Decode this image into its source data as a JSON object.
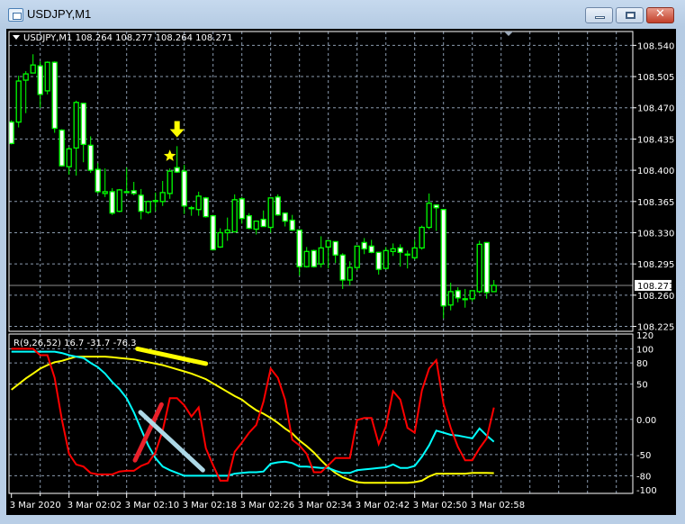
{
  "window": {
    "title": "USDJPY,M1",
    "buttons": {
      "minimize": "minimize",
      "maximize": "maximize",
      "close": "✕"
    }
  },
  "chart_data": [
    {
      "type": "candlestick",
      "header": "USDJPY,M1  108.264 108.277 108.264 108.271",
      "symbol": "USDJPY,M1",
      "ohlc_header": [
        108.264,
        108.277,
        108.264,
        108.271
      ],
      "ylim": [
        108.2195,
        108.5555
      ],
      "y_ticks": [
        "108.540",
        "108.505",
        "108.470",
        "108.435",
        "108.400",
        "108.365",
        "108.330",
        "108.295",
        "108.260",
        "108.225"
      ],
      "current_price": "108.271",
      "grid": true,
      "colors": {
        "candle_outline": "#00ff00",
        "bear_fill": "#ffffff",
        "bull_fill": "#000000",
        "grid": "#8a9aae",
        "price_line": "#8c8c8c"
      },
      "candles_ohlc": [
        [
          108.454,
          108.456,
          108.429,
          108.43
        ],
        [
          108.454,
          108.506,
          108.448,
          108.5
        ],
        [
          108.501,
          108.511,
          108.464,
          108.508
        ],
        [
          108.509,
          108.53,
          108.509,
          108.518
        ],
        [
          108.517,
          108.522,
          108.47,
          108.485
        ],
        [
          108.489,
          108.522,
          108.485,
          108.521
        ],
        [
          108.521,
          108.522,
          108.442,
          108.447
        ],
        [
          108.445,
          108.446,
          108.404,
          108.405
        ],
        [
          108.404,
          108.426,
          108.395,
          108.424
        ],
        [
          108.425,
          108.478,
          108.394,
          108.476
        ],
        [
          108.475,
          108.475,
          108.409,
          108.429
        ],
        [
          108.428,
          108.438,
          108.397,
          108.4
        ],
        [
          108.401,
          108.408,
          108.374,
          108.376
        ],
        [
          108.374,
          108.402,
          108.37,
          108.376
        ],
        [
          108.376,
          108.38,
          108.35,
          108.352
        ],
        [
          108.354,
          108.379,
          108.353,
          108.378
        ],
        [
          108.376,
          108.403,
          108.375,
          108.376
        ],
        [
          108.377,
          108.387,
          108.372,
          108.374
        ],
        [
          108.372,
          108.379,
          108.345,
          108.354
        ],
        [
          108.353,
          108.366,
          108.351,
          108.365
        ],
        [
          108.366,
          108.375,
          108.354,
          108.366
        ],
        [
          108.365,
          108.388,
          108.36,
          108.375
        ],
        [
          108.374,
          108.402,
          108.368,
          108.399
        ],
        [
          108.403,
          108.427,
          108.397,
          108.398
        ],
        [
          108.399,
          108.406,
          108.351,
          108.36
        ],
        [
          108.358,
          108.36,
          108.349,
          108.358
        ],
        [
          108.356,
          108.376,
          108.349,
          108.371
        ],
        [
          108.369,
          108.37,
          108.347,
          108.348
        ],
        [
          108.349,
          108.35,
          108.31,
          108.311
        ],
        [
          108.314,
          108.335,
          108.313,
          108.33
        ],
        [
          108.33,
          108.347,
          108.321,
          108.333
        ],
        [
          108.331,
          108.373,
          108.331,
          108.367
        ],
        [
          108.368,
          108.37,
          108.34,
          108.346
        ],
        [
          108.349,
          108.352,
          108.334,
          108.335
        ],
        [
          108.334,
          108.343,
          108.328,
          108.343
        ],
        [
          108.345,
          108.355,
          108.337,
          108.337
        ],
        [
          108.336,
          108.369,
          108.33,
          108.369
        ],
        [
          108.37,
          108.373,
          108.349,
          108.35
        ],
        [
          108.352,
          108.352,
          108.337,
          108.343
        ],
        [
          108.344,
          108.35,
          108.332,
          108.333
        ],
        [
          108.333,
          108.333,
          108.282,
          108.292
        ],
        [
          108.292,
          108.314,
          108.291,
          108.309
        ],
        [
          108.31,
          108.311,
          108.291,
          108.292
        ],
        [
          108.295,
          108.326,
          108.291,
          108.313
        ],
        [
          108.314,
          108.321,
          108.29,
          108.321
        ],
        [
          108.32,
          108.32,
          108.296,
          108.305
        ],
        [
          108.305,
          108.307,
          108.267,
          108.277
        ],
        [
          108.277,
          108.298,
          108.271,
          108.291
        ],
        [
          108.291,
          108.315,
          108.288,
          108.315
        ],
        [
          108.319,
          108.324,
          108.306,
          108.312
        ],
        [
          108.315,
          108.322,
          108.307,
          108.308
        ],
        [
          108.308,
          108.308,
          108.283,
          108.289
        ],
        [
          108.29,
          108.314,
          108.29,
          108.31
        ],
        [
          108.309,
          108.318,
          108.304,
          108.312
        ],
        [
          108.313,
          108.317,
          108.292,
          108.308
        ],
        [
          108.306,
          108.31,
          108.29,
          108.306
        ],
        [
          108.302,
          108.322,
          108.3,
          108.313
        ],
        [
          108.313,
          108.338,
          108.311,
          108.336
        ],
        [
          108.336,
          108.374,
          108.334,
          108.363
        ],
        [
          108.361,
          108.361,
          108.332,
          108.358
        ],
        [
          108.356,
          108.356,
          108.234,
          108.248
        ],
        [
          108.249,
          108.274,
          108.243,
          108.264
        ],
        [
          108.265,
          108.269,
          108.252,
          108.257
        ],
        [
          108.256,
          108.267,
          108.246,
          108.256
        ],
        [
          108.256,
          108.265,
          108.253,
          108.265
        ],
        [
          108.264,
          108.321,
          108.262,
          108.317
        ],
        [
          108.319,
          108.319,
          108.256,
          108.263
        ],
        [
          108.264,
          108.277,
          108.264,
          108.271
        ]
      ],
      "objects": [
        {
          "kind": "arrow-down",
          "time": "02:17",
          "price": 108.444,
          "color": "#ffff00"
        },
        {
          "kind": "star",
          "time": "02:16",
          "price": 108.416,
          "color": "#ffff00"
        }
      ]
    },
    {
      "type": "line",
      "header": "R(9,26,52) 16.7 -31.7 -76.3",
      "label": "R(9,26,52)",
      "last_values": [
        "16.7",
        "-31.7",
        "-76.3"
      ],
      "ylim": [
        -105,
        121
      ],
      "y_ticks": [
        "120",
        "100",
        "80",
        "50",
        "0.00",
        "-50",
        "-80",
        "-100"
      ],
      "grid_levels": [
        100,
        80,
        50,
        0,
        -50,
        -80
      ],
      "series": [
        {
          "color": "#ff0000",
          "values": [
            100,
            100,
            100,
            100,
            91,
            91,
            59,
            0,
            -49,
            -64,
            -67,
            -76,
            -78,
            -78,
            -78,
            -74,
            -73,
            -73,
            -66,
            -62,
            -47,
            -16,
            30,
            30,
            20,
            4,
            17,
            -41,
            -65,
            -87,
            -87,
            -46,
            -33,
            -19,
            -8,
            25,
            72,
            59,
            28,
            -29,
            -37,
            -49,
            -75,
            -75,
            -65,
            -55,
            -55,
            -55,
            -1,
            2,
            2,
            -35,
            -10,
            40,
            28,
            -12,
            -19,
            41,
            72,
            84,
            22,
            -12,
            -39,
            -58,
            -58,
            -41,
            -27,
            16.7
          ]
        },
        {
          "color": "#00ffff",
          "values": [
            96,
            96,
            96,
            96,
            96,
            96,
            96,
            94,
            91,
            89,
            87,
            80,
            74,
            65,
            53,
            43,
            30,
            10,
            -14,
            -37,
            -55,
            -67,
            -72,
            -76,
            -80,
            -80,
            -80,
            -80,
            -80,
            -80,
            -80,
            -77,
            -76,
            -75,
            -75,
            -74,
            -63,
            -61,
            -60,
            -62,
            -67,
            -67,
            -68,
            -69,
            -69,
            -73,
            -76,
            -76,
            -72,
            -71,
            -70,
            -69,
            -68,
            -64,
            -69,
            -69,
            -66,
            -53,
            -37,
            -16,
            -19,
            -22,
            -23,
            -25,
            -27,
            -13,
            -23,
            -31.7
          ]
        },
        {
          "color": "#ffff00",
          "values": [
            42,
            50,
            58,
            65,
            72,
            77,
            81,
            83,
            86,
            89,
            89,
            89,
            89,
            89,
            88,
            87,
            86,
            85,
            83,
            81,
            79,
            77,
            74,
            71,
            68,
            65,
            61,
            57,
            51,
            45,
            39,
            33,
            28,
            20,
            13,
            8,
            2,
            -5,
            -13,
            -20,
            -30,
            -38,
            -47,
            -58,
            -68,
            -76,
            -82,
            -86,
            -89,
            -90,
            -90,
            -90,
            -90,
            -90,
            -90,
            -90,
            -89,
            -87,
            -81,
            -77,
            -77,
            -77,
            -77,
            -77,
            -76,
            -76,
            -76,
            -76.3
          ]
        }
      ],
      "objects": [
        {
          "kind": "trendline",
          "color": "#ffff00",
          "from": {
            "time": "02:11:30",
            "value": 100
          },
          "to": {
            "time": "02:21",
            "value": 79
          }
        },
        {
          "kind": "trendline",
          "color": "#e8202a",
          "from": {
            "time": "02:11:10",
            "value": -58
          },
          "to": {
            "time": "02:14:50",
            "value": 21
          }
        },
        {
          "kind": "trendline",
          "color": "#add8e6",
          "from": {
            "time": "02:11:55",
            "value": 10
          },
          "to": {
            "time": "02:20:35",
            "value": -72
          }
        }
      ]
    }
  ],
  "time_axis": {
    "labels": [
      "3 Mar 2020",
      "3 Mar 02:02",
      "3 Mar 02:10",
      "3 Mar 02:18",
      "3 Mar 02:26",
      "3 Mar 02:34",
      "3 Mar 02:42",
      "3 Mar 02:50",
      "3 Mar 02:58"
    ]
  }
}
